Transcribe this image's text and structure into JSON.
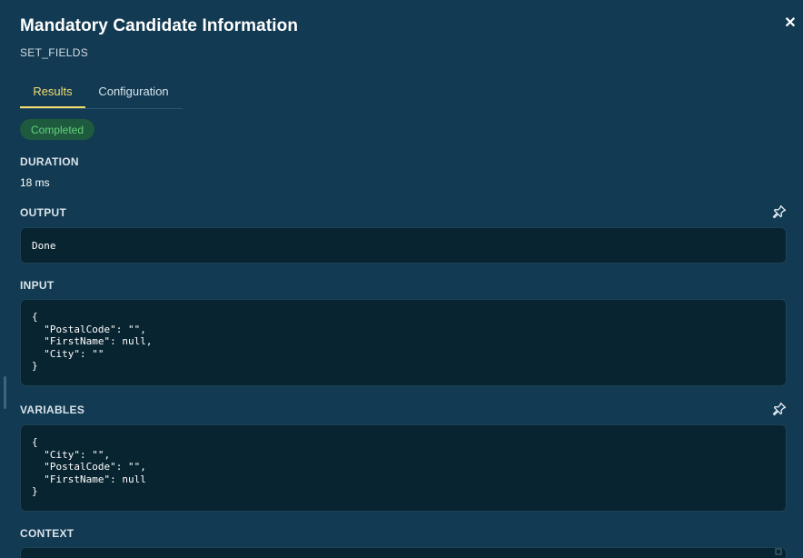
{
  "header": {
    "title": "Mandatory Candidate Information",
    "subtitle": "SET_FIELDS",
    "close_icon": "close-icon"
  },
  "tabs": [
    {
      "label": "Results",
      "active": true
    },
    {
      "label": "Configuration",
      "active": false
    }
  ],
  "status": {
    "label": "Completed",
    "color": "#63d17d"
  },
  "duration": {
    "label": "DURATION",
    "value": "18 ms"
  },
  "output": {
    "label": "OUTPUT",
    "value": "Done",
    "pin_icon": "pin-icon"
  },
  "input": {
    "label": "INPUT",
    "value": "{\n  \"PostalCode\": \"\",\n  \"FirstName\": null,\n  \"City\": \"\"\n}"
  },
  "variables": {
    "label": "VARIABLES",
    "value": "{\n  \"City\": \"\",\n  \"PostalCode\": \"\",\n  \"FirstName\": null\n}",
    "pin_icon": "pin-icon"
  },
  "context": {
    "label": "CONTEXT"
  },
  "colors": {
    "background": "#123a52",
    "accent": "#f2dc6c",
    "code_background": "#082430"
  }
}
